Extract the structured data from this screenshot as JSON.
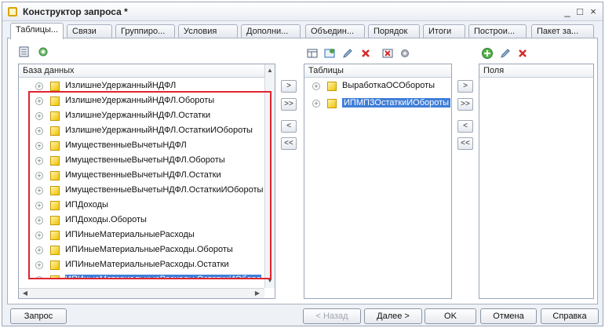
{
  "window": {
    "title": "Конструктор запроса *",
    "controls": [
      "_",
      "□",
      "×"
    ]
  },
  "tabs": [
    "Таблицы...",
    "Связи",
    "Группиро...",
    "Условия",
    "Дополни...",
    "Объедин...",
    "Порядок",
    "Итоги",
    "Построи...",
    "Пакет за..."
  ],
  "database_panel": {
    "header": "База данных",
    "items": [
      "ИзлишнеУдержанныйНДФЛ",
      "ИзлишнеУдержанныйНДФЛ.Обороты",
      "ИзлишнеУдержанныйНДФЛ.Остатки",
      "ИзлишнеУдержанныйНДФЛ.ОстаткиИОбороты",
      "ИмущественныеВычетыНДФЛ",
      "ИмущественныеВычетыНДФЛ.Обороты",
      "ИмущественныеВычетыНДФЛ.Остатки",
      "ИмущественныеВычетыНДФЛ.ОстаткиИОбороты",
      "ИПДоходы",
      "ИПДоходы.Обороты",
      "ИПИныеМатериальныеРасходы",
      "ИПИныеМатериальныеРасходы.Обороты",
      "ИПИныеМатериальныеРасходы.Остатки",
      "ИПИныеМатериальныеРасходы.ОстаткиИОборо"
    ]
  },
  "tables_panel": {
    "header": "Таблицы",
    "items": [
      "ВыработкаОСОбороты",
      "ИПМПЗОстаткиИОбороты"
    ],
    "selected_index": 1
  },
  "fields_panel": {
    "header": "Поля"
  },
  "move_buttons": [
    ">",
    ">>",
    "<",
    "<<"
  ],
  "footer": {
    "query": "Запрос",
    "back": "< Назад",
    "next": "Далее >",
    "ok": "OK",
    "cancel": "Отмена",
    "help": "Справка"
  },
  "colors": {
    "highlight_box": "#e0242e",
    "selection": "#3f7ed7"
  }
}
